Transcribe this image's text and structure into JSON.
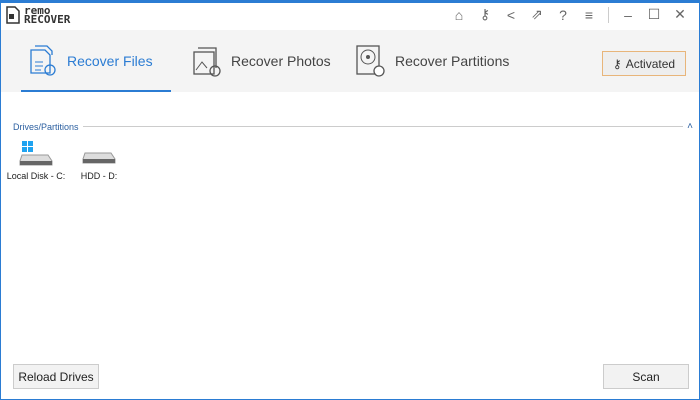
{
  "app": {
    "logo_line1": "remo",
    "logo_line2": "RECOVER"
  },
  "titlebar": {
    "icons": [
      "home-icon",
      "key-icon",
      "share-icon",
      "external-link-icon",
      "help-icon",
      "menu-icon",
      "minimize-icon",
      "maximize-icon",
      "close-icon"
    ],
    "glyphs": [
      "⌂",
      "⚷",
      "<",
      "⇗",
      "?",
      "≡",
      "–",
      "☐",
      "✕"
    ]
  },
  "tabs": [
    {
      "label": "Recover Files",
      "active": true
    },
    {
      "label": "Recover Photos"
    },
    {
      "label": "Recover Partitions"
    }
  ],
  "activated_label": "Activated",
  "section_title": "Drives/Partitions",
  "section_toggle": "˄",
  "drives": [
    {
      "label": "Local Disk - C:",
      "system": true
    },
    {
      "label": "HDD - D:"
    }
  ],
  "buttons": {
    "reload": "Reload Drives",
    "scan": "Scan"
  },
  "colors": {
    "accent": "#2b7cd3",
    "activated_border": "#e8b57a",
    "windows_logo": "#1fa3f0"
  }
}
